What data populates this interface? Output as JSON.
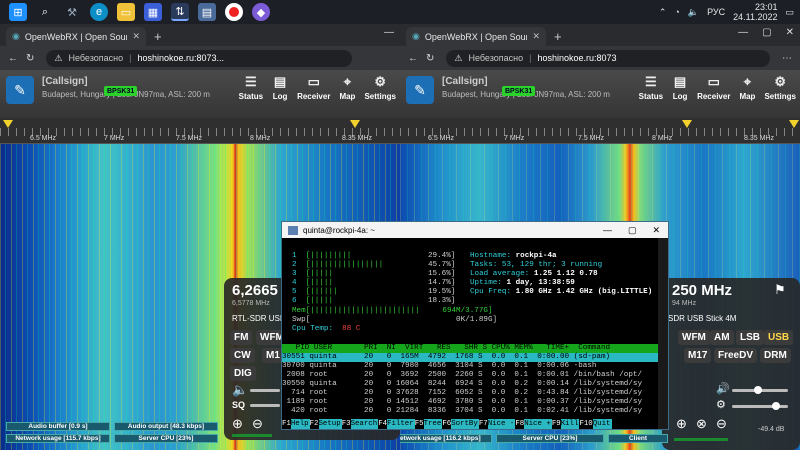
{
  "taskbar": {
    "clock_time": "23:01",
    "clock_date": "24.11.2022",
    "lang": "РУС",
    "icons": [
      "windows-icon",
      "search-icon",
      "tools-icon",
      "edge-icon",
      "files-icon",
      "store-icon",
      "network-icon",
      "calculator-icon",
      "record-icon",
      "app-icon"
    ]
  },
  "browser": {
    "tab_title": "OpenWebRX | Open Source SDR",
    "insecure_label": "Небезопасно",
    "url_left": "hoshinokoe.ru:8073...",
    "url_right": "hoshinokoe.ru:8073"
  },
  "owx": {
    "callsign": "[Callsign]",
    "location": "Budapest, Hungary | Loc: JN97ma, ASL: 200 m",
    "nav": [
      "Status",
      "Log",
      "Receiver",
      "Map",
      "Settings"
    ],
    "badge_left": "BPSK31",
    "badge_right": "BPSK31"
  },
  "scale_left": [
    "6.5 MHz",
    "7 MHz",
    "7.5 MHz",
    "8 MHz",
    "8.35 MHz"
  ],
  "scale_right": [
    "6.5 MHz",
    "7 MHz",
    "7.5 MHz",
    "8 MHz",
    "8.35 MHz"
  ],
  "rx_left": {
    "freq": "6,2665 M",
    "freq_sub": "6,5778 MHz",
    "device": "RTL-SDR USB S",
    "modes_row1": [
      "FM",
      "WFM"
    ],
    "modes_row2": [
      "CW",
      "M1"
    ],
    "modes_row3": [
      "DIG"
    ],
    "sq_label": "SQ",
    "audio_buffer": "Audio buffer [0.9 s]",
    "audio_output": "Audio output [48.3 kbps]",
    "network": "Network usage [115.7 kbps]",
    "cpu": "Server CPU [23%]"
  },
  "rx_right": {
    "freq": "250 MHz",
    "freq_sub": "94 MHz",
    "device": "SDR USB Stick 4M",
    "modes_row1": [
      "WFM",
      "AM",
      "LSB",
      "USB"
    ],
    "modes_row2": [
      "M17",
      "FreeDV",
      "DRM"
    ],
    "level": "-49.4 dB",
    "network": "Network usage [116.2 kbps]",
    "cpu": "Server CPU [23%]",
    "clients": "Client"
  },
  "terminal": {
    "title": "quinta@rockpi-4a: ~",
    "cpus": [
      {
        "n": "1",
        "bar": "[|||||||||",
        "pct": "29.4%]"
      },
      {
        "n": "2",
        "bar": "[||||||||||||||||",
        "pct": "45.7%]"
      },
      {
        "n": "3",
        "bar": "[|||||",
        "pct": "15.6%]"
      },
      {
        "n": "4",
        "bar": "[|||||",
        "pct": "14.7%]"
      },
      {
        "n": "5",
        "bar": "[||||||",
        "pct": "19.5%]"
      },
      {
        "n": "6",
        "bar": "[|||||",
        "pct": "18.3%]"
      }
    ],
    "mem": "Mem[||||||||||||||||||||||||     694M/3.77G]",
    "swp": "Swp[                                0K/1.89G]",
    "cpu_temp_label": "Cpu Temp:",
    "cpu_temp_value": "88 C",
    "hostname_label": "Hostname:",
    "hostname": "rockpi-4a",
    "tasks": "Tasks: 53, 129 thr; 3 running",
    "load_label": "Load average:",
    "load": "1.25 1.12 0.78",
    "uptime_label": "Uptime:",
    "uptime": "1 day, 13:38:59",
    "cpufreq_label": "Cpu Freq:",
    "cpufreq": "1.80 GHz 1.42 GHz (big.LITTLE)",
    "header": "   PID USER       PRI  NI  VIRT   RES   SHR S CPU% MEM%   TIME+  Command",
    "processes": [
      "30551 quinta      20   0  165M  4792  1768 S  0.0  0.1  0:00.00 (sd-pam)",
      "30700 quinta      20   0  7980  4656  3104 S  0.0  0.1  0:00.06 -bash",
      " 2008 root        20   0  3692  2500  2260 S  0.0  0.1  0:00.01 /bin/bash /opt/",
      "30550 quinta      20   0 16064  8244  6924 S  0.0  0.2  0:00.14 /lib/systemd/sy",
      "  714 root        20   0 37628  7152  6052 S  0.0  0.2  0:43.84 /lib/systemd/sy",
      " 1189 root        20   0 14512  4692  3780 S  0.0  0.1  0:00.37 /lib/systemd/sy",
      "  420 root        20   0 21284  8336  3704 S  0.0  0.1  0:02.41 /lib/systemd/sy"
    ],
    "fkeys": [
      {
        "n": "F1",
        "l": "Help"
      },
      {
        "n": "F2",
        "l": "Setup"
      },
      {
        "n": "F3",
        "l": "Search"
      },
      {
        "n": "F4",
        "l": "Filter"
      },
      {
        "n": "F5",
        "l": "Tree"
      },
      {
        "n": "F6",
        "l": "SortBy"
      },
      {
        "n": "F7",
        "l": "Nice -"
      },
      {
        "n": "F8",
        "l": "Nice +"
      },
      {
        "n": "F9",
        "l": "Kill"
      },
      {
        "n": "F10",
        "l": "Quit"
      }
    ]
  }
}
